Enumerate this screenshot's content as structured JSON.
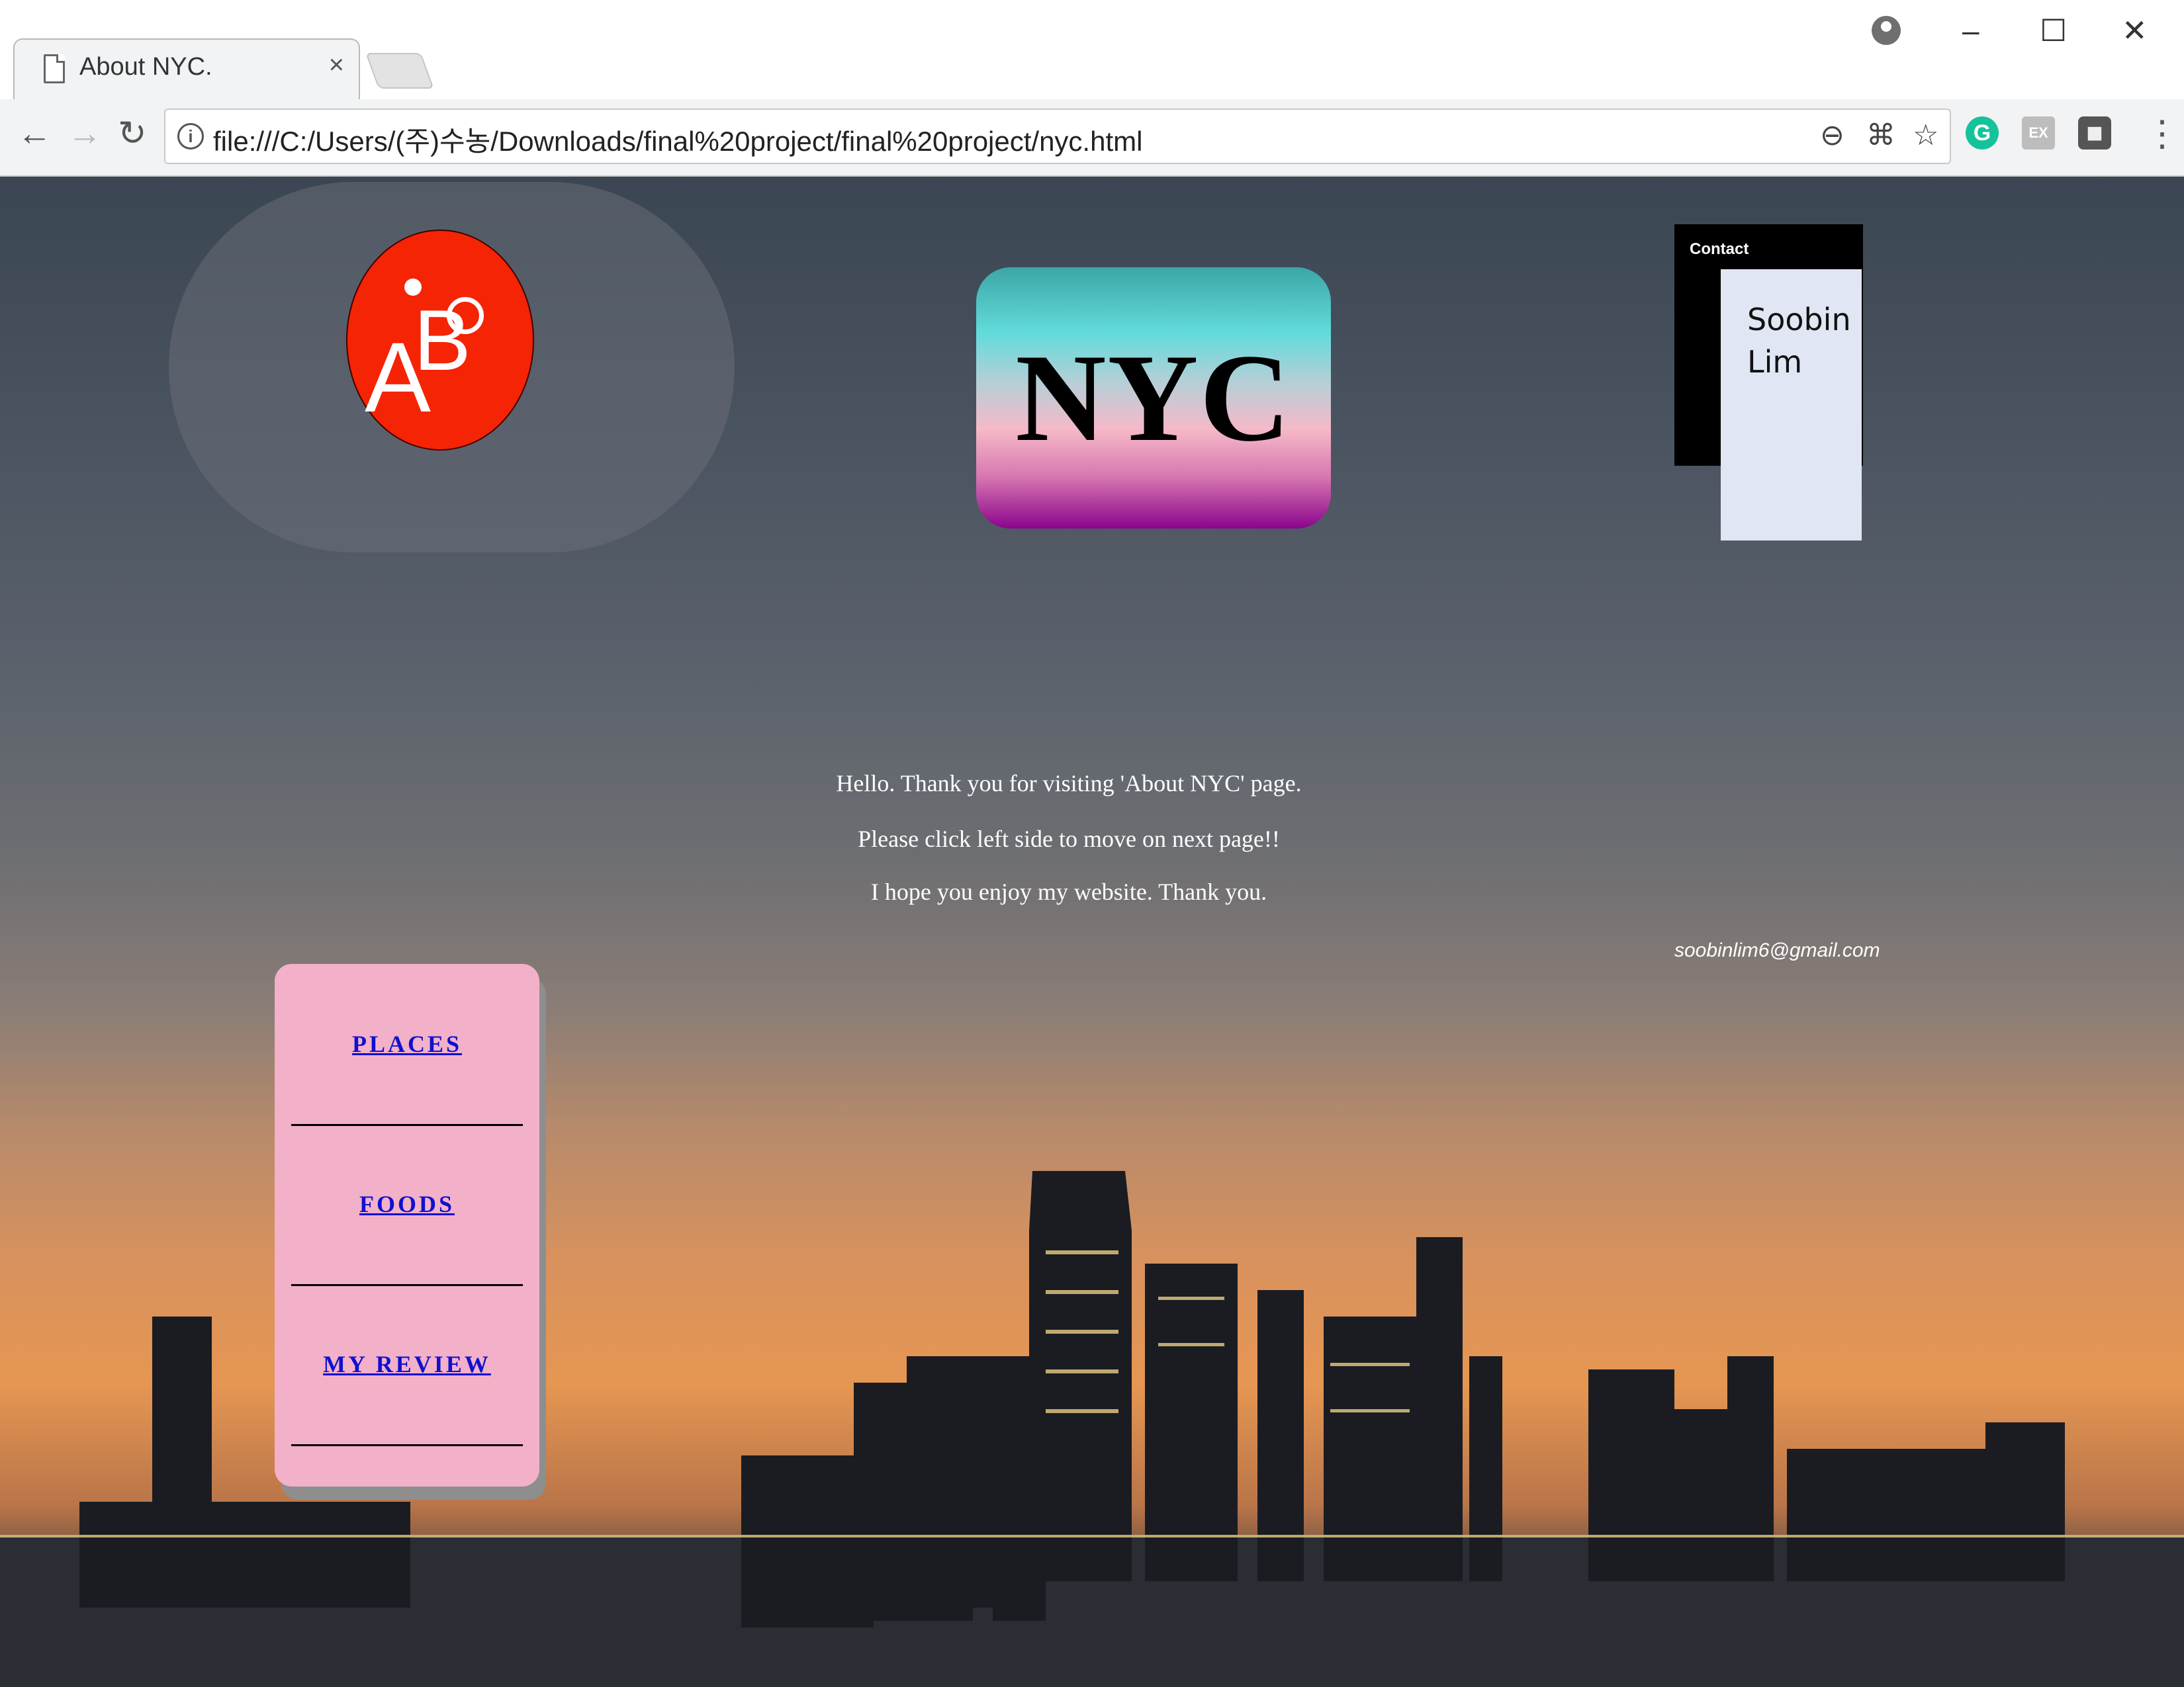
{
  "browser": {
    "tab_title": "About NYC.",
    "tab_close": "×",
    "url": "file:///C:/Users/(주)수농/Downloads/final%20project/final%20project/nyc.html",
    "window_controls": {
      "minimize": "–",
      "maximize": "☐",
      "close": "✕"
    },
    "nav": {
      "back": "←",
      "forward": "→",
      "reload": "↻"
    },
    "omnibox_icons": [
      "zoom-out-icon",
      "translate-icon",
      "bookmark-star-icon"
    ],
    "extensions": [
      {
        "name": "grammarly-icon",
        "glyph": "G",
        "color": "#15c39a"
      },
      {
        "name": "ex-extension-icon",
        "glyph": "EX",
        "color": "#bdbdbd"
      },
      {
        "name": "shield-extension-icon",
        "glyph": "◼",
        "color": "#666666"
      }
    ],
    "menu_glyph": "⋮"
  },
  "page": {
    "logo": {
      "letter_a": "A",
      "letter_b": "B"
    },
    "title": "NYC",
    "contact": {
      "label": "Contact",
      "name_line1": "Soobin",
      "name_line2": "Lim",
      "email": "soobinlim6@gmail.com"
    },
    "messages": [
      "Hello. Thank you for visiting 'About NYC' page.",
      "Please click left side to move on next page!!",
      "I hope you enjoy my website. Thank you."
    ],
    "menu": [
      {
        "label": "PLACES"
      },
      {
        "label": "FOODS"
      },
      {
        "label": "MY REVIEW"
      }
    ]
  },
  "colors": {
    "logo_red": "#f52405",
    "menu_pink": "#f2b0c9",
    "link_blue": "#1010d0",
    "contact_card": "#e1e6f4"
  }
}
